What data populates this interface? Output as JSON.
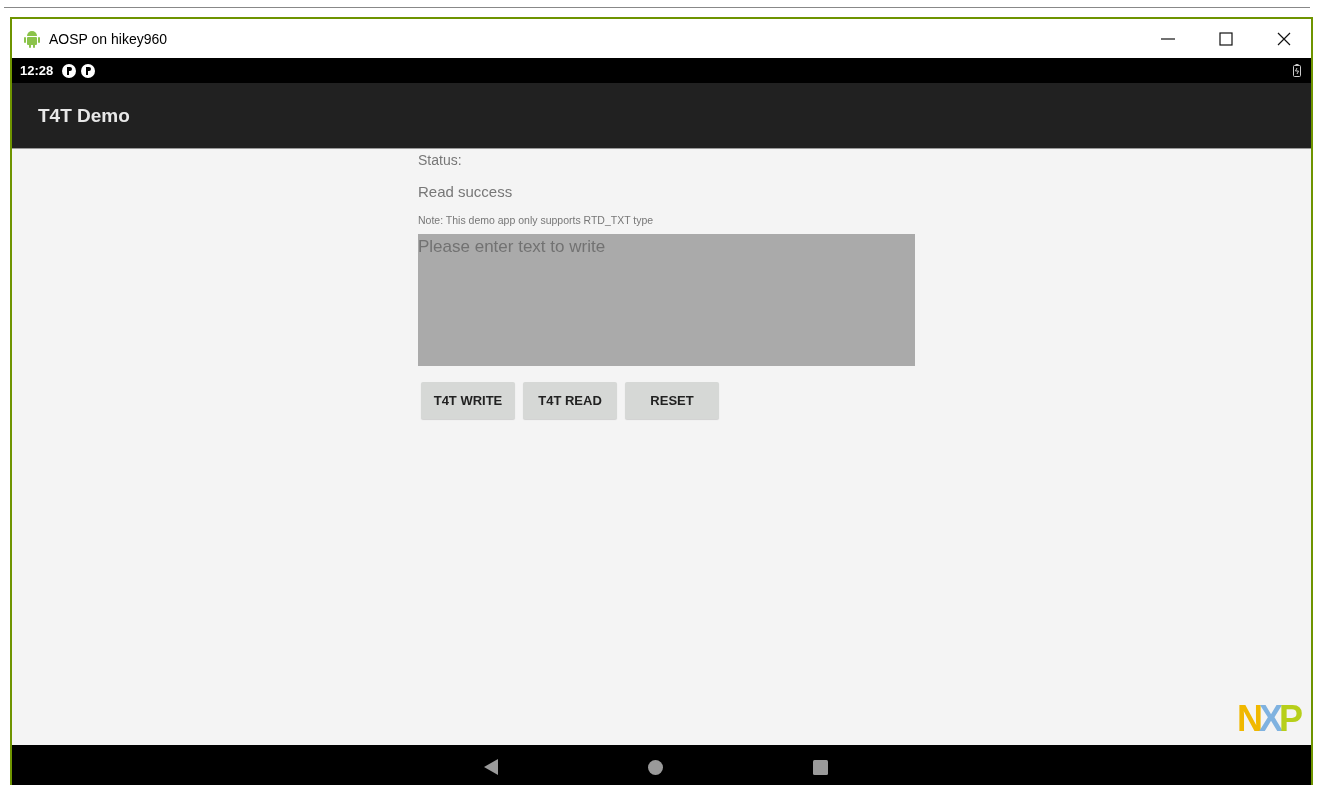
{
  "window": {
    "title": "AOSP on hikey960"
  },
  "status_bar": {
    "time": "12:28"
  },
  "app_bar": {
    "title": "T4T Demo"
  },
  "content": {
    "status_label": "Status:",
    "status_value": "Read success",
    "note": "Note: This demo app only supports RTD_TXT type",
    "text_field": {
      "placeholder": "Please enter text to write"
    },
    "buttons": [
      "T4T WRITE",
      "T4T READ",
      "RESET"
    ]
  },
  "logo": {
    "letters": [
      {
        "text": "N",
        "color": "#f0b800"
      },
      {
        "text": "X",
        "color": "#7fb2e0"
      },
      {
        "text": "P",
        "color": "#b7cf1a"
      }
    ]
  }
}
